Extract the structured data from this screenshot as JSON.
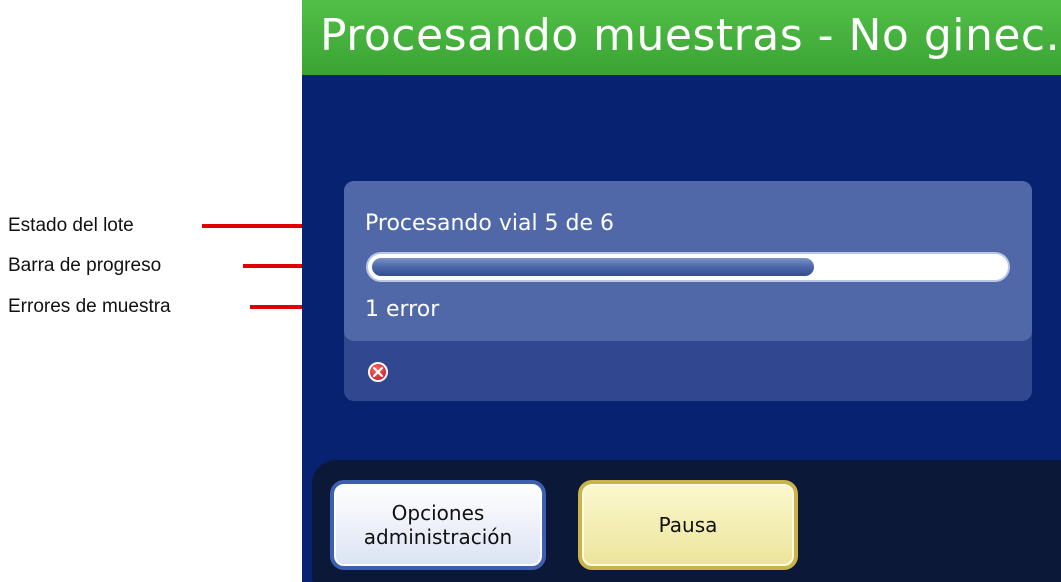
{
  "callouts": [
    {
      "label": "Estado del lote"
    },
    {
      "label": "Barra de progreso"
    },
    {
      "label": "Errores de muestra"
    }
  ],
  "header": {
    "title": "Procesando muestras - No ginec."
  },
  "batch": {
    "status": "Procesando vial 5 de 6",
    "progress_fraction": 0.7,
    "errors": "1 error"
  },
  "icons": {
    "error": "error-x-icon"
  },
  "buttons": {
    "admin_line1": "Opciones",
    "admin_line2": "administración",
    "pause": "Pausa"
  },
  "colors": {
    "header_green": "#4cb843",
    "screen_blue": "#082272",
    "panel_blue": "#5168a8",
    "error_red": "#d01818",
    "callout_red": "#e00000"
  }
}
